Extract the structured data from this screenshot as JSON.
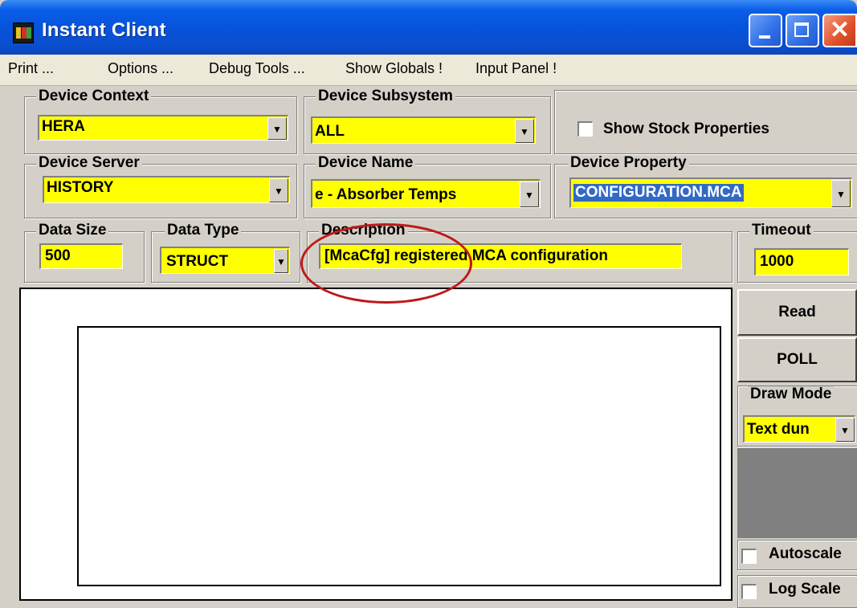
{
  "window": {
    "title": "Instant Client",
    "controls": {
      "minimize": "minimize-icon",
      "maximize": "maximize-icon",
      "close": "close-icon"
    }
  },
  "menu": [
    "Print ...",
    "Options ...",
    "Debug Tools ...",
    "Show Globals !",
    "Input Panel !"
  ],
  "device_context": {
    "label": "Device Context",
    "value": "HERA"
  },
  "device_subsystem": {
    "label": "Device Subsystem",
    "value": "ALL"
  },
  "show_stock_properties": {
    "label": "Show Stock Properties",
    "checked": false
  },
  "device_server": {
    "label": "Device Server",
    "value": "HISTORY"
  },
  "device_name": {
    "label": "Device Name",
    "value": "e - Absorber Temps"
  },
  "device_property": {
    "label": "Device Property",
    "value": "CONFIGURATION.MCA"
  },
  "data_size": {
    "label": "Data Size",
    "value": "500"
  },
  "data_type": {
    "label": "Data Type",
    "value": "STRUCT"
  },
  "description": {
    "label": "Description",
    "value": "[McaCfg] registered MCA configuration"
  },
  "timeout": {
    "label": "Timeout",
    "value": "1000"
  },
  "buttons": {
    "read": "Read",
    "poll": "POLL"
  },
  "draw_mode": {
    "label": "Draw Mode",
    "value": "Text dun"
  },
  "autoscale": {
    "label": "Autoscale",
    "checked": false
  },
  "log_scale": {
    "label": "Log Scale",
    "checked": false
  },
  "colors": {
    "field_bg": "#ffff00",
    "annotation": "#c01818",
    "selection": "#316ac5"
  }
}
